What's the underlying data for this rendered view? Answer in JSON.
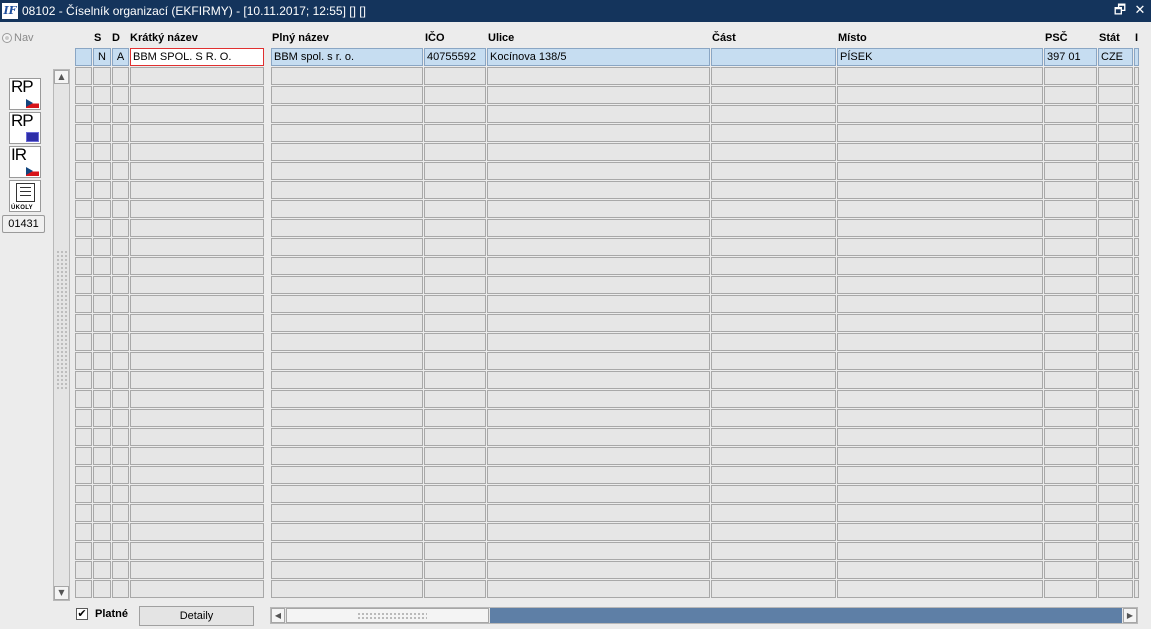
{
  "window": {
    "icon_text": "IF",
    "title": "08102 - Číselník organizací (EKFIRMY) - [10.11.2017; 12:55]  [] []",
    "restore_glyph": "🗗",
    "close_glyph": "✕"
  },
  "sidebar": {
    "nav_label": "Nav",
    "buttons": [
      {
        "letters": "RP",
        "flag": "cz"
      },
      {
        "letters": "RP",
        "flag": "eu"
      },
      {
        "letters": "IR",
        "flag": "cz"
      },
      {
        "letters": "",
        "label": "ÚKOLY"
      }
    ],
    "code": "01431"
  },
  "table": {
    "headers": {
      "s": "S",
      "d": "D",
      "kratky_nazev": "Krátký název",
      "plny_nazev": "Plný název",
      "ico": "IČO",
      "ulice": "Ulice",
      "cast": "Část",
      "misto": "Místo",
      "psc": "PSČ",
      "stat": "Stát",
      "extra": "I"
    },
    "selected_row": {
      "s": "N",
      "d": "A",
      "kratky_nazev": "BBM SPOL. S R. O.",
      "plny_nazev": "BBM spol. s r. o.",
      "ico": "40755592",
      "ulice": "Kocínova 138/5",
      "cast": "",
      "misto": "PÍSEK",
      "psc": "397 01",
      "stat": "CZE"
    },
    "empty_rows": 28
  },
  "footer": {
    "platne_checked": true,
    "platne_label": "Platné",
    "detail_button": "Detaily"
  }
}
